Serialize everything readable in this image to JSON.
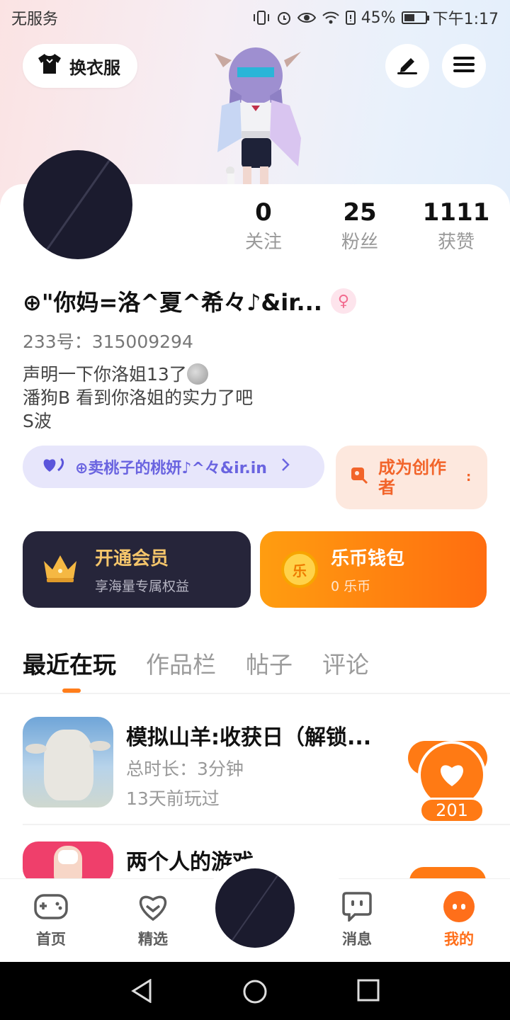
{
  "status_bar": {
    "carrier": "无服务",
    "battery_percent": "45%",
    "time": "下午1:17"
  },
  "top": {
    "change_clothes_label": "换衣服"
  },
  "profile": {
    "stats": [
      {
        "value": "0",
        "label": "关注"
      },
      {
        "value": "25",
        "label": "粉丝"
      },
      {
        "value": "1111",
        "label": "获赞"
      }
    ],
    "username": "⊕\"你妈=洛^夏^希々♪&ir...",
    "uid": "233号：315009294",
    "bio_lines": [
      "声明一下你洛姐13了",
      "潘狗B 看到你洛姐的实力了吧",
      "S波"
    ]
  },
  "guild_pill": {
    "label": "⊕卖桃子的桃妍♪^々&ir.in"
  },
  "creator_pill": {
    "label": "成为创作者"
  },
  "vip_card": {
    "title": "开通会员",
    "subtitle": "享海量专属权益"
  },
  "wallet_card": {
    "title": "乐币钱包",
    "subtitle": "0 乐币",
    "coin_char": "乐"
  },
  "tabs": [
    "最近在玩",
    "作品栏",
    "帖子",
    "评论"
  ],
  "games": [
    {
      "title": "模拟山羊:收获日（解锁...",
      "duration": "总时长：3分钟",
      "last_played": "13天前玩过"
    },
    {
      "title": "两个人的游戏"
    }
  ],
  "like_badge": {
    "count": "201"
  },
  "bottom_nav": [
    {
      "label": "首页"
    },
    {
      "label": "精选"
    },
    {
      "label": "消息"
    },
    {
      "label": "我的"
    }
  ],
  "colors": {
    "accent": "#ff6f1a",
    "vip_bg": "#26253a",
    "guild_text": "#6a64e0"
  }
}
